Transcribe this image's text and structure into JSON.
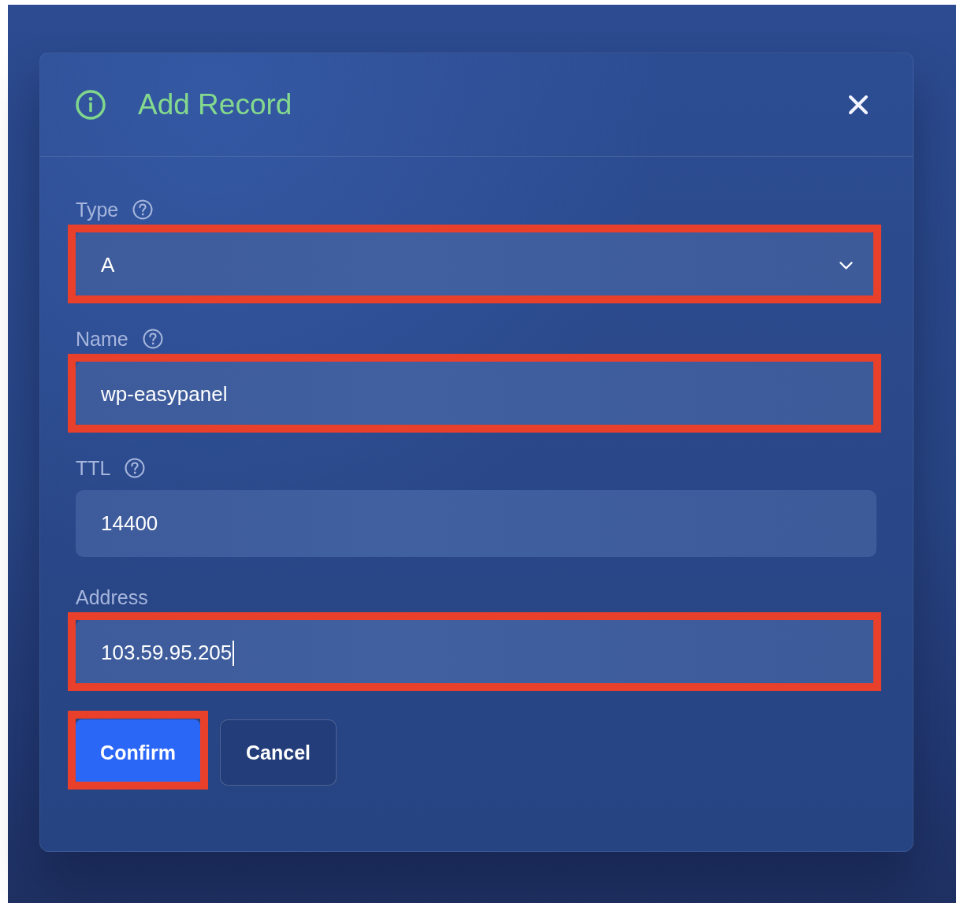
{
  "dialog": {
    "title": "Add Record",
    "fields": [
      {
        "kind": "select",
        "label": "Type",
        "help": true,
        "value": "A",
        "highlighted": true,
        "focused": false
      },
      {
        "kind": "input",
        "label": "Name",
        "help": true,
        "value": "wp-easypanel",
        "highlighted": true,
        "focused": false
      },
      {
        "kind": "input",
        "label": "TTL",
        "help": true,
        "value": "14400",
        "highlighted": false,
        "focused": false
      },
      {
        "kind": "input",
        "label": "Address",
        "help": false,
        "value": "103.59.95.205",
        "highlighted": true,
        "focused": true
      }
    ],
    "buttons": [
      {
        "kind": "primary",
        "label": "Confirm",
        "highlighted": true
      },
      {
        "kind": "secondary",
        "label": "Cancel",
        "highlighted": false
      }
    ]
  }
}
